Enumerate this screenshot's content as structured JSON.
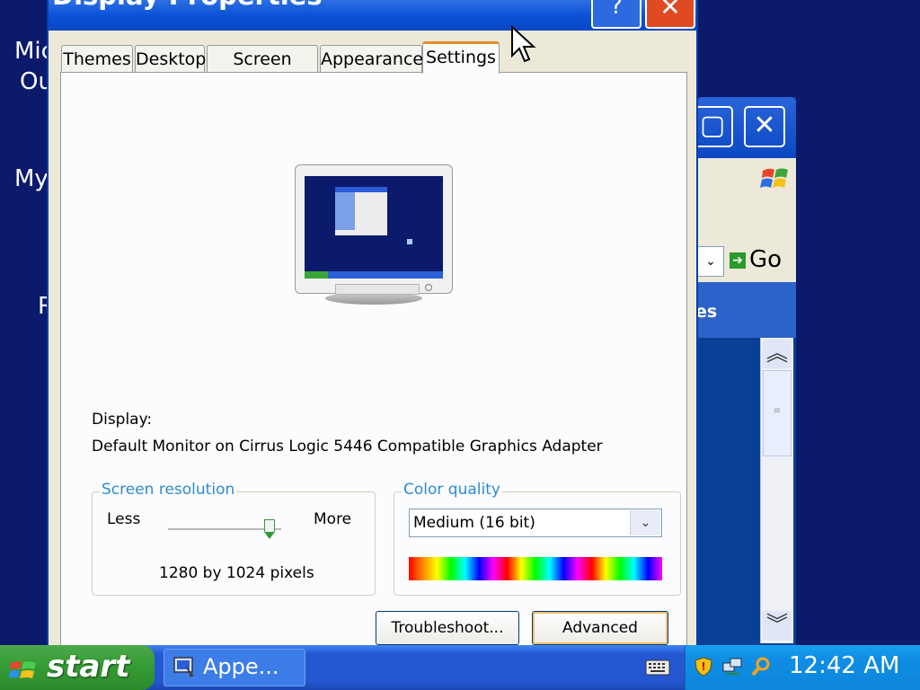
{
  "desktop": {
    "labels": [
      "Mic",
      "Ou",
      "My",
      "R"
    ]
  },
  "background_window": {
    "maximize_glyph": "▢",
    "close_glyph": "✕",
    "go_label": "Go",
    "tasks_header_fragment": "es"
  },
  "dialog": {
    "title": "Display Properties",
    "help_glyph": "?",
    "close_glyph": "✕",
    "tabs": [
      "Themes",
      "Desktop",
      "Screen Saver",
      "Appearance",
      "Settings"
    ],
    "active_tab": "Settings",
    "display_label": "Display:",
    "display_value": "Default Monitor on Cirrus Logic 5446 Compatible Graphics Adapter",
    "screen_resolution": {
      "title": "Screen resolution",
      "less": "Less",
      "more": "More",
      "value_text": "1280 by 1024 pixels",
      "slider_position_percent": 90
    },
    "color_quality": {
      "title": "Color quality",
      "selected": "Medium (16 bit)"
    },
    "buttons": {
      "troubleshoot": "Troubleshoot...",
      "advanced": "Advanced"
    }
  },
  "taskbar": {
    "start_label": "start",
    "task_item_label": "Appe...",
    "clock": "12:42 AM"
  },
  "colors": {
    "desktop": "#0b1a6b",
    "title_bar": "#0b52d6",
    "close_button": "#e04a23",
    "start_button": "#379e37",
    "tab_highlight": "#e68b2c",
    "groupbox_title": "#2e8bd0"
  }
}
